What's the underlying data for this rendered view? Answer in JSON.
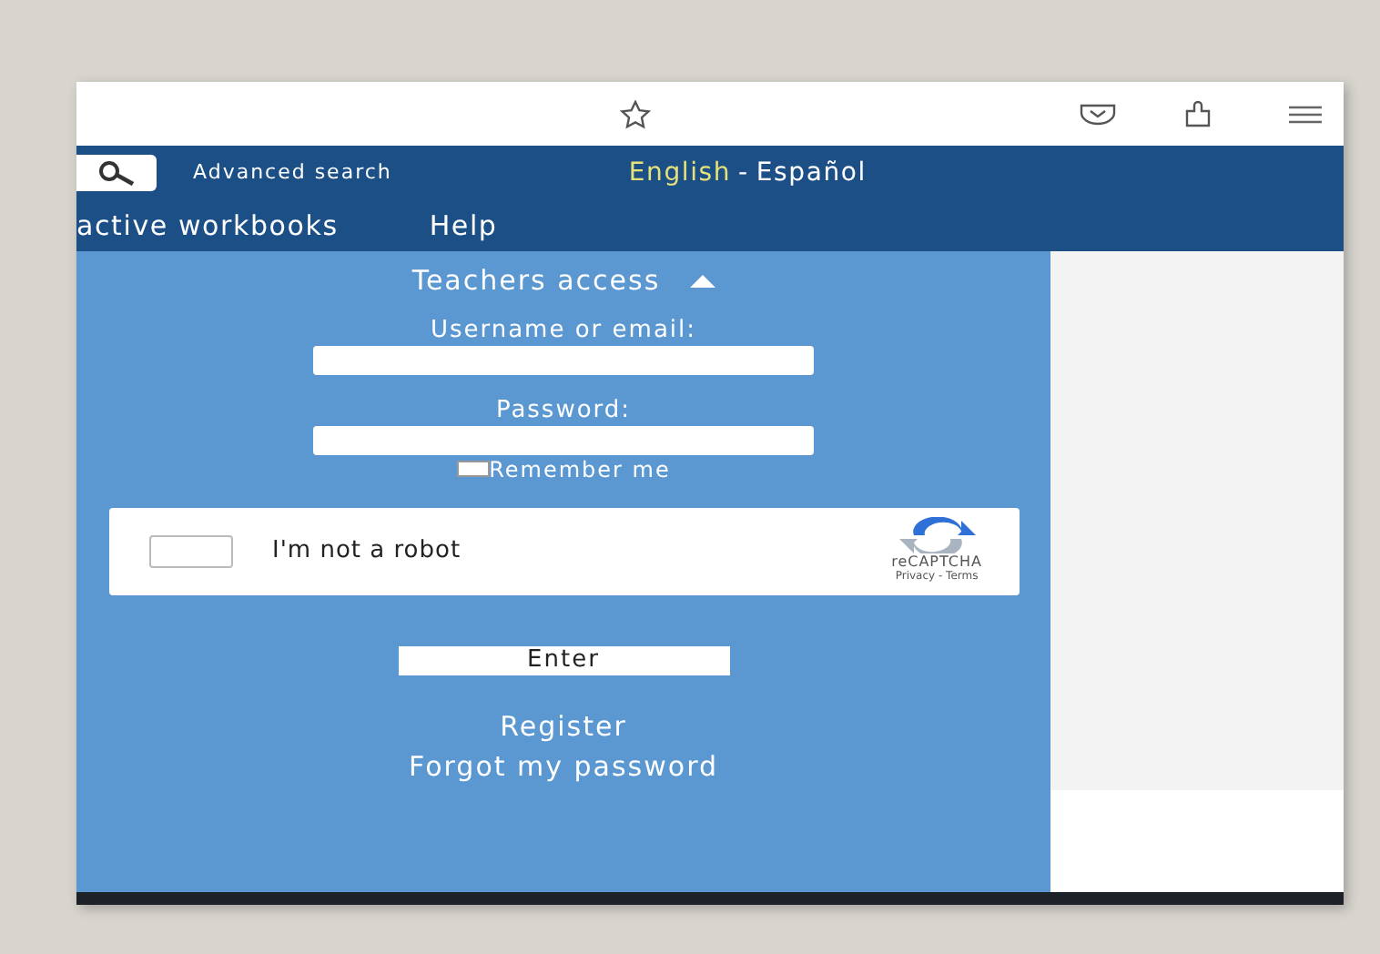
{
  "header": {
    "search_link": "Advanced search",
    "languages": [
      {
        "label": "English",
        "selected": true
      },
      {
        "label": "Español",
        "selected": false
      }
    ],
    "separator": "-"
  },
  "nav": [
    "active workbooks",
    "Help"
  ],
  "login": {
    "title": "Teachers access",
    "expanded": true,
    "fields": [
      {
        "label": "Username or email:"
      },
      {
        "label": "Password:"
      }
    ],
    "remember": {
      "label": "Remember me",
      "checked": false
    },
    "captcha": {
      "label": "I'm not a robot",
      "checked": false,
      "brand": "reCAPTCHA",
      "links": "Privacy - Terms"
    },
    "submit": "Enter",
    "links": [
      "Register",
      "Forgot my password"
    ]
  }
}
